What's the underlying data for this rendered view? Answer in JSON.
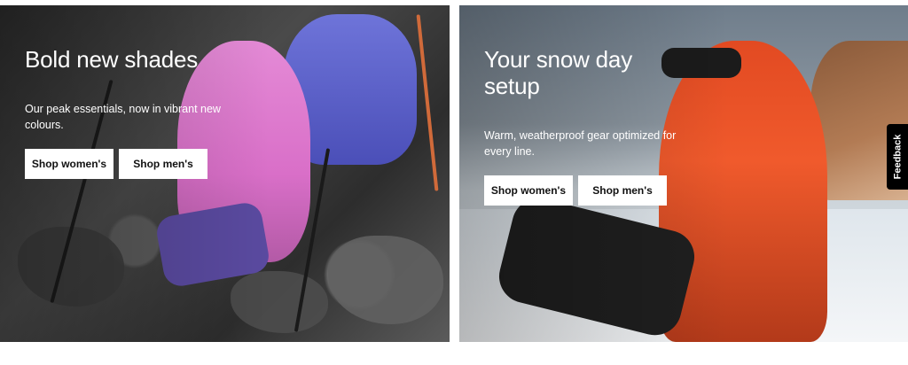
{
  "promo_left": {
    "headline": "Bold new shades",
    "subtext": "Our peak essentials, now in vibrant new colours.",
    "buttons": {
      "women": "Shop women's",
      "men": "Shop men's"
    }
  },
  "promo_right": {
    "headline": "Your snow day setup",
    "subtext": "Warm, weatherproof gear optimized for every line.",
    "buttons": {
      "women": "Shop women's",
      "men": "Shop men's"
    }
  },
  "feedback": {
    "label": "Feedback"
  },
  "colors": {
    "button_bg": "#ffffff",
    "button_text": "#111111",
    "feedback_bg": "#000000"
  },
  "icons": {
    "left_image": "hikers-rocky-slope-image",
    "right_image": "snowboarder-mountain-image"
  }
}
